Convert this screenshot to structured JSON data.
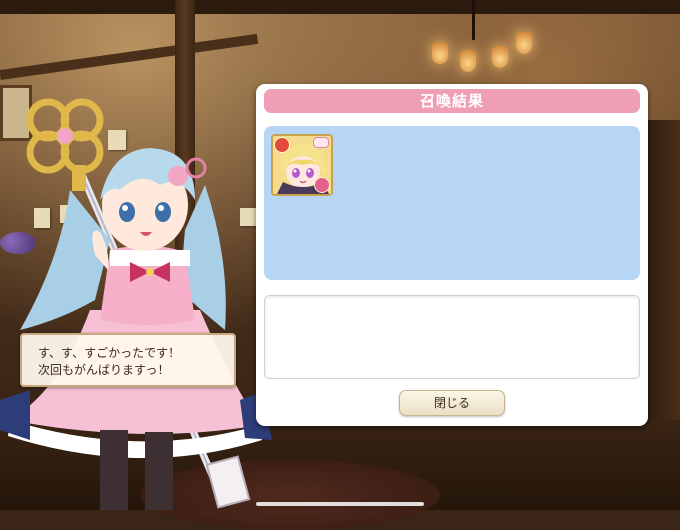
{
  "dialog": {
    "title": "召喚結果",
    "result_cards": [
      {
        "name": "",
        "rarity_badge_color": "#e24b3a",
        "element_badge_color": "#e4608a"
      }
    ],
    "message": "",
    "close_label": "閉じる"
  },
  "speech": {
    "line1": "す、す、すごかったです！",
    "line2": "次回もがんばりますっ！"
  },
  "colors": {
    "header": "#ee9fb6",
    "results_bg": "#b7d6f5",
    "panel_bg": "#ffffff"
  }
}
